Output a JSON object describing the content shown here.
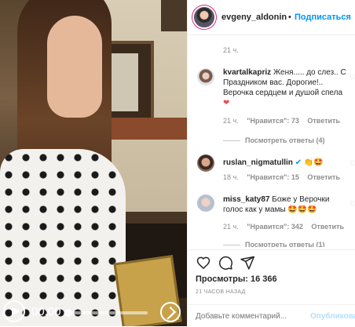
{
  "video": {
    "time": "00:00",
    "play_icon": "play-icon",
    "fullscreen_icon": "fullscreen-icon"
  },
  "header": {
    "username": "evgeny_aldonin",
    "dot": "•",
    "follow_label": "Подписаться"
  },
  "comments": {
    "top_time": "21 ч.",
    "items": [
      {
        "username": "kvartalkapriz",
        "text": "Женя..... до слез.. С Праздником вас. Дорогие!.. Верочка сердцем и душой спела",
        "emoji": "❤",
        "time": "21 ч.",
        "likes": "\"Нравится\": 73",
        "reply": "Ответить",
        "view_replies": "Посмотреть ответы (4)"
      },
      {
        "username": "ruslan_nigmatullin",
        "text": "👏🤩",
        "time": "18 ч.",
        "likes": "\"Нравится\": 15",
        "reply": "Ответить"
      },
      {
        "username": "miss_katy87",
        "text": "Боже у Верочки голос как у мамы 🤩🤩🤩",
        "time": "21 ч.",
        "likes": "\"Нравится\": 342",
        "reply": "Ответить",
        "view_replies": "Посмотреть ответы (1)"
      }
    ]
  },
  "actions": {
    "like_icon": "heart-icon",
    "comment_icon": "comment-icon",
    "share_icon": "share-icon"
  },
  "stats": {
    "views": "Просмотры: 16 366",
    "ago": "21 ЧАСОВ НАЗАД"
  },
  "add_comment": {
    "placeholder": "Добавьте комментарий...",
    "post_label": "Опубликовать"
  },
  "colors": {
    "accent": "#0095f6",
    "muted": "#8e8e8e",
    "post_disabled": "#b2dffc"
  }
}
